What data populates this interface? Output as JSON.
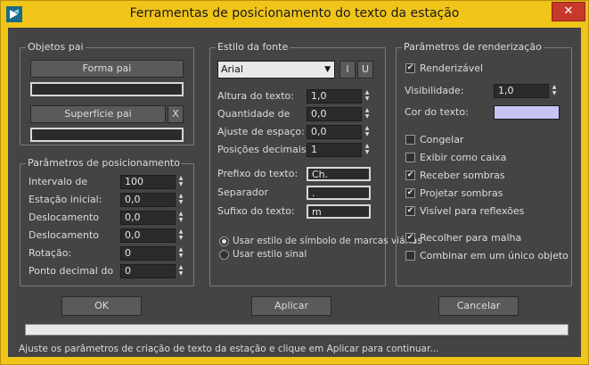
{
  "window": {
    "title": "Ferramentas de posicionamento do texto da estação",
    "close_glyph": "✕"
  },
  "parent_objects": {
    "legend": "Objetos pai",
    "parent_shape_button": "Forma pai",
    "parent_shape_value": "",
    "parent_surface_button": "Superfície pai",
    "clear_surface_button": "X",
    "parent_surface_value": ""
  },
  "positioning": {
    "legend": "Parâmetros de posicionamento",
    "rows": [
      {
        "label": "Intervalo de",
        "value": "100"
      },
      {
        "label": "Estação inicial:",
        "value": "0,0"
      },
      {
        "label": "Deslocamento",
        "value": "0,0"
      },
      {
        "label": "Deslocamento",
        "value": "0,0"
      },
      {
        "label": "Rotação:",
        "value": "0"
      },
      {
        "label": "Ponto decimal do",
        "value": "0"
      }
    ]
  },
  "font_style": {
    "legend": "Estilo da fonte",
    "font_name": "Arial",
    "italic_button": "I",
    "underline_button": "U",
    "rows": [
      {
        "label": "Altura do texto:",
        "value": "1,0"
      },
      {
        "label": "Quantidade de",
        "value": "0,0"
      },
      {
        "label": "Ajuste de espaço:",
        "value": "0,0"
      },
      {
        "label": "Posições decimais:",
        "value": "1"
      }
    ],
    "prefix_label": "Prefixo do texto:",
    "prefix_value": "Ch.",
    "separator_label": "Separador",
    "separator_value": ".",
    "suffix_label": "Sufixo do texto:",
    "suffix_value": "m",
    "radio_road_sign": "Usar estilo de símbolo de marcas viárias",
    "radio_signal": "Usar estilo sinal"
  },
  "render": {
    "legend": "Parâmetros de renderização",
    "renderable": "Renderizável",
    "visibility_label": "Visibilidade:",
    "visibility_value": "1,0",
    "text_color_label": "Cor do texto:",
    "text_color": "#c7c5f5",
    "freeze": "Congelar",
    "display_as_box": "Exibir como caixa",
    "receive_shadows": "Receber sombras",
    "cast_shadows": "Projetar sombras",
    "visible_reflections": "Visível para reflexões",
    "collapse_mesh": "Recolher para malha",
    "combine_single": "Combinar em um único objeto"
  },
  "buttons": {
    "ok": "OK",
    "apply": "Aplicar",
    "cancel": "Cancelar"
  },
  "progress_fraction": 0,
  "status_text": "Ajuste os parâmetros de criação de texto da estação e clique em Aplicar para continuar...",
  "colors": {
    "titlebar": "#f0c419",
    "panel": "#444444",
    "close": "#c7392b"
  }
}
